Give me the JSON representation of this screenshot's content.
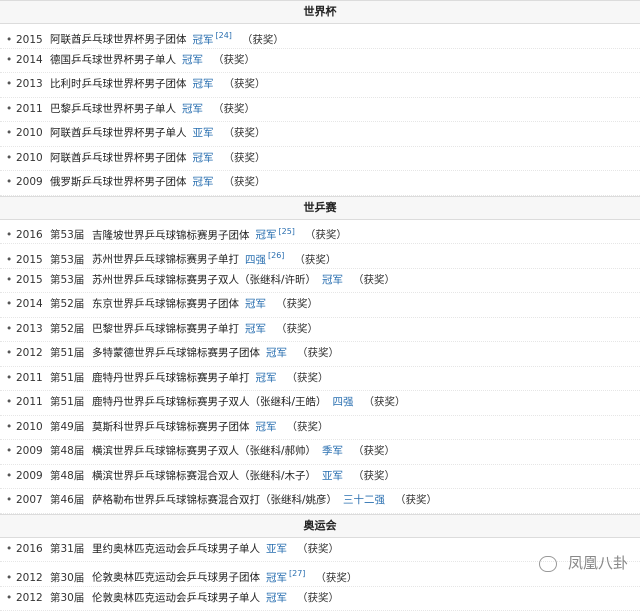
{
  "sections": [
    {
      "title": "世界杯",
      "rows": [
        {
          "year": "2015",
          "edition": "",
          "event": "阿联酋乒乓球世界杯男子团体",
          "result": "冠军",
          "ref": "[24]",
          "award": "（获奖）"
        },
        {
          "year": "2014",
          "edition": "",
          "event": "德国乒乓球世界杯男子单人",
          "result": "冠军",
          "ref": "",
          "award": "（获奖）"
        },
        {
          "year": "2013",
          "edition": "",
          "event": "比利时乒乓球世界杯男子团体",
          "result": "冠军",
          "ref": "",
          "award": "（获奖）"
        },
        {
          "year": "2011",
          "edition": "",
          "event": "巴黎乒乓球世界杯男子单人",
          "result": "冠军",
          "ref": "",
          "award": "（获奖）"
        },
        {
          "year": "2010",
          "edition": "",
          "event": "阿联酋乒乓球世界杯男子单人",
          "result": "亚军",
          "ref": "",
          "award": "（获奖）"
        },
        {
          "year": "2010",
          "edition": "",
          "event": "阿联酋乒乓球世界杯男子团体",
          "result": "冠军",
          "ref": "",
          "award": "（获奖）"
        },
        {
          "year": "2009",
          "edition": "",
          "event": "俄罗斯乒乓球世界杯男子团体",
          "result": "冠军",
          "ref": "",
          "award": "（获奖）"
        }
      ]
    },
    {
      "title": "世乒赛",
      "rows": [
        {
          "year": "2016",
          "edition": "第53届",
          "event": "吉隆坡世界乒乓球锦标赛男子团体",
          "result": "冠军",
          "ref": "[25]",
          "award": "（获奖）"
        },
        {
          "year": "2015",
          "edition": "第53届",
          "event": "苏州世界乒乓球锦标赛男子单打",
          "result": "四强",
          "ref": "[26]",
          "award": "（获奖）"
        },
        {
          "year": "2015",
          "edition": "第53届",
          "event": "苏州世界乒乓球锦标赛男子双人（张继科/许昕）",
          "result": "冠军",
          "ref": "",
          "award": "（获奖）"
        },
        {
          "year": "2014",
          "edition": "第52届",
          "event": "东京世界乒乓球锦标赛男子团体",
          "result": "冠军",
          "ref": "",
          "award": "（获奖）"
        },
        {
          "year": "2013",
          "edition": "第52届",
          "event": "巴黎世界乒乓球锦标赛男子单打",
          "result": "冠军",
          "ref": "",
          "award": "（获奖）"
        },
        {
          "year": "2012",
          "edition": "第51届",
          "event": "多特蒙德世界乒乓球锦标赛男子团体",
          "result": "冠军",
          "ref": "",
          "award": "（获奖）"
        },
        {
          "year": "2011",
          "edition": "第51届",
          "event": "鹿特丹世界乒乓球锦标赛男子单打",
          "result": "冠军",
          "ref": "",
          "award": "（获奖）"
        },
        {
          "year": "2011",
          "edition": "第51届",
          "event": "鹿特丹世界乒乓球锦标赛男子双人（张继科/王皓）",
          "result": "四强",
          "ref": "",
          "award": "（获奖）"
        },
        {
          "year": "2010",
          "edition": "第49届",
          "event": "莫斯科世界乒乓球锦标赛男子团体",
          "result": "冠军",
          "ref": "",
          "award": "（获奖）"
        },
        {
          "year": "2009",
          "edition": "第48届",
          "event": "横滨世界乒乓球锦标赛男子双人（张继科/郝帅）",
          "result": "季军",
          "ref": "",
          "award": "（获奖）"
        },
        {
          "year": "2009",
          "edition": "第48届",
          "event": "横滨世界乒乓球锦标赛混合双人（张继科/木子）",
          "result": "亚军",
          "ref": "",
          "award": "（获奖）"
        },
        {
          "year": "2007",
          "edition": "第46届",
          "event": "萨格勒布世界乒乓球锦标赛混合双打（张继科/姚彦）",
          "result": "三十二强",
          "ref": "",
          "award": "（获奖）"
        }
      ]
    },
    {
      "title": "奥运会",
      "rows": [
        {
          "year": "2016",
          "edition": "第31届",
          "event": "里约奥林匹克运动会乒乓球男子单人",
          "result": "亚军",
          "ref": "",
          "award": "（获奖）"
        },
        {
          "year": "2012",
          "edition": "第30届",
          "event": "伦敦奥林匹克运动会乒乓球男子团体",
          "result": "冠军",
          "ref": "[27]",
          "award": "（获奖）"
        },
        {
          "year": "2012",
          "edition": "第30届",
          "event": "伦敦奥林匹克运动会乒乓球男子单人",
          "result": "冠军",
          "ref": "",
          "award": "（获奖）"
        }
      ]
    }
  ],
  "watermark": "凤凰八卦",
  "colors": {
    "link": "#2a6fb0",
    "header_bg": "#f7f7f7"
  }
}
